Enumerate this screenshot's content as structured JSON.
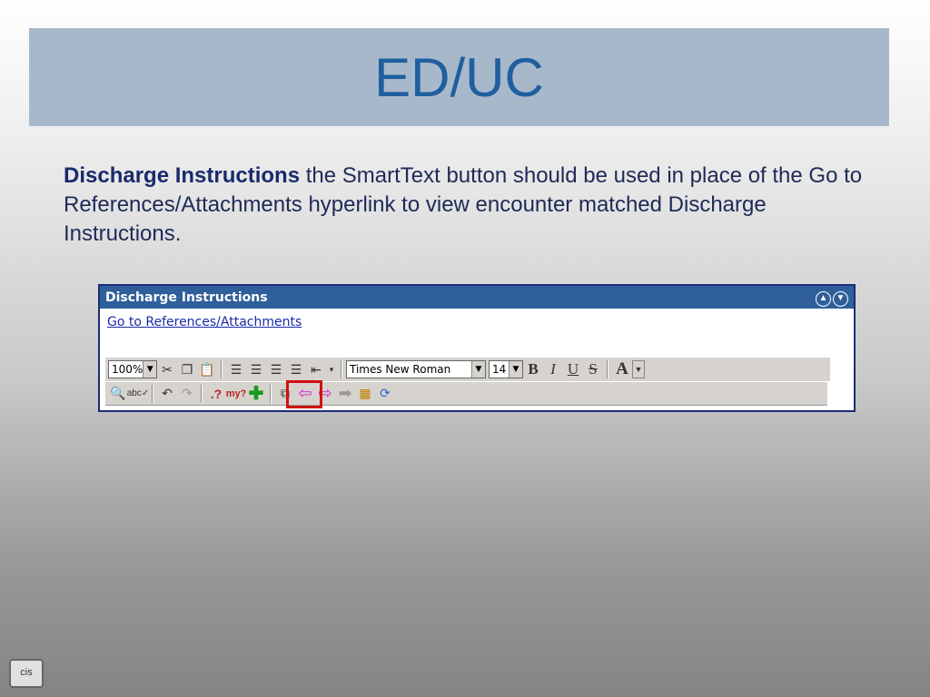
{
  "slide": {
    "title": "ED/UC",
    "body_bold": "Discharge Instructions",
    "body_rest": " the SmartText button should be used in place of the Go to References/Attachments hyperlink to view encounter matched Discharge Instructions.",
    "logo_text": "cis"
  },
  "panel": {
    "title": "Discharge Instructions",
    "link": "Go to References/Attachments",
    "zoom": "100%",
    "font_name": "Times New Roman",
    "font_size": "14",
    "bold": "B",
    "italic": "I",
    "underline": "U",
    "strike": "S",
    "font_color": "A",
    "highlight_color": "#d01010"
  }
}
